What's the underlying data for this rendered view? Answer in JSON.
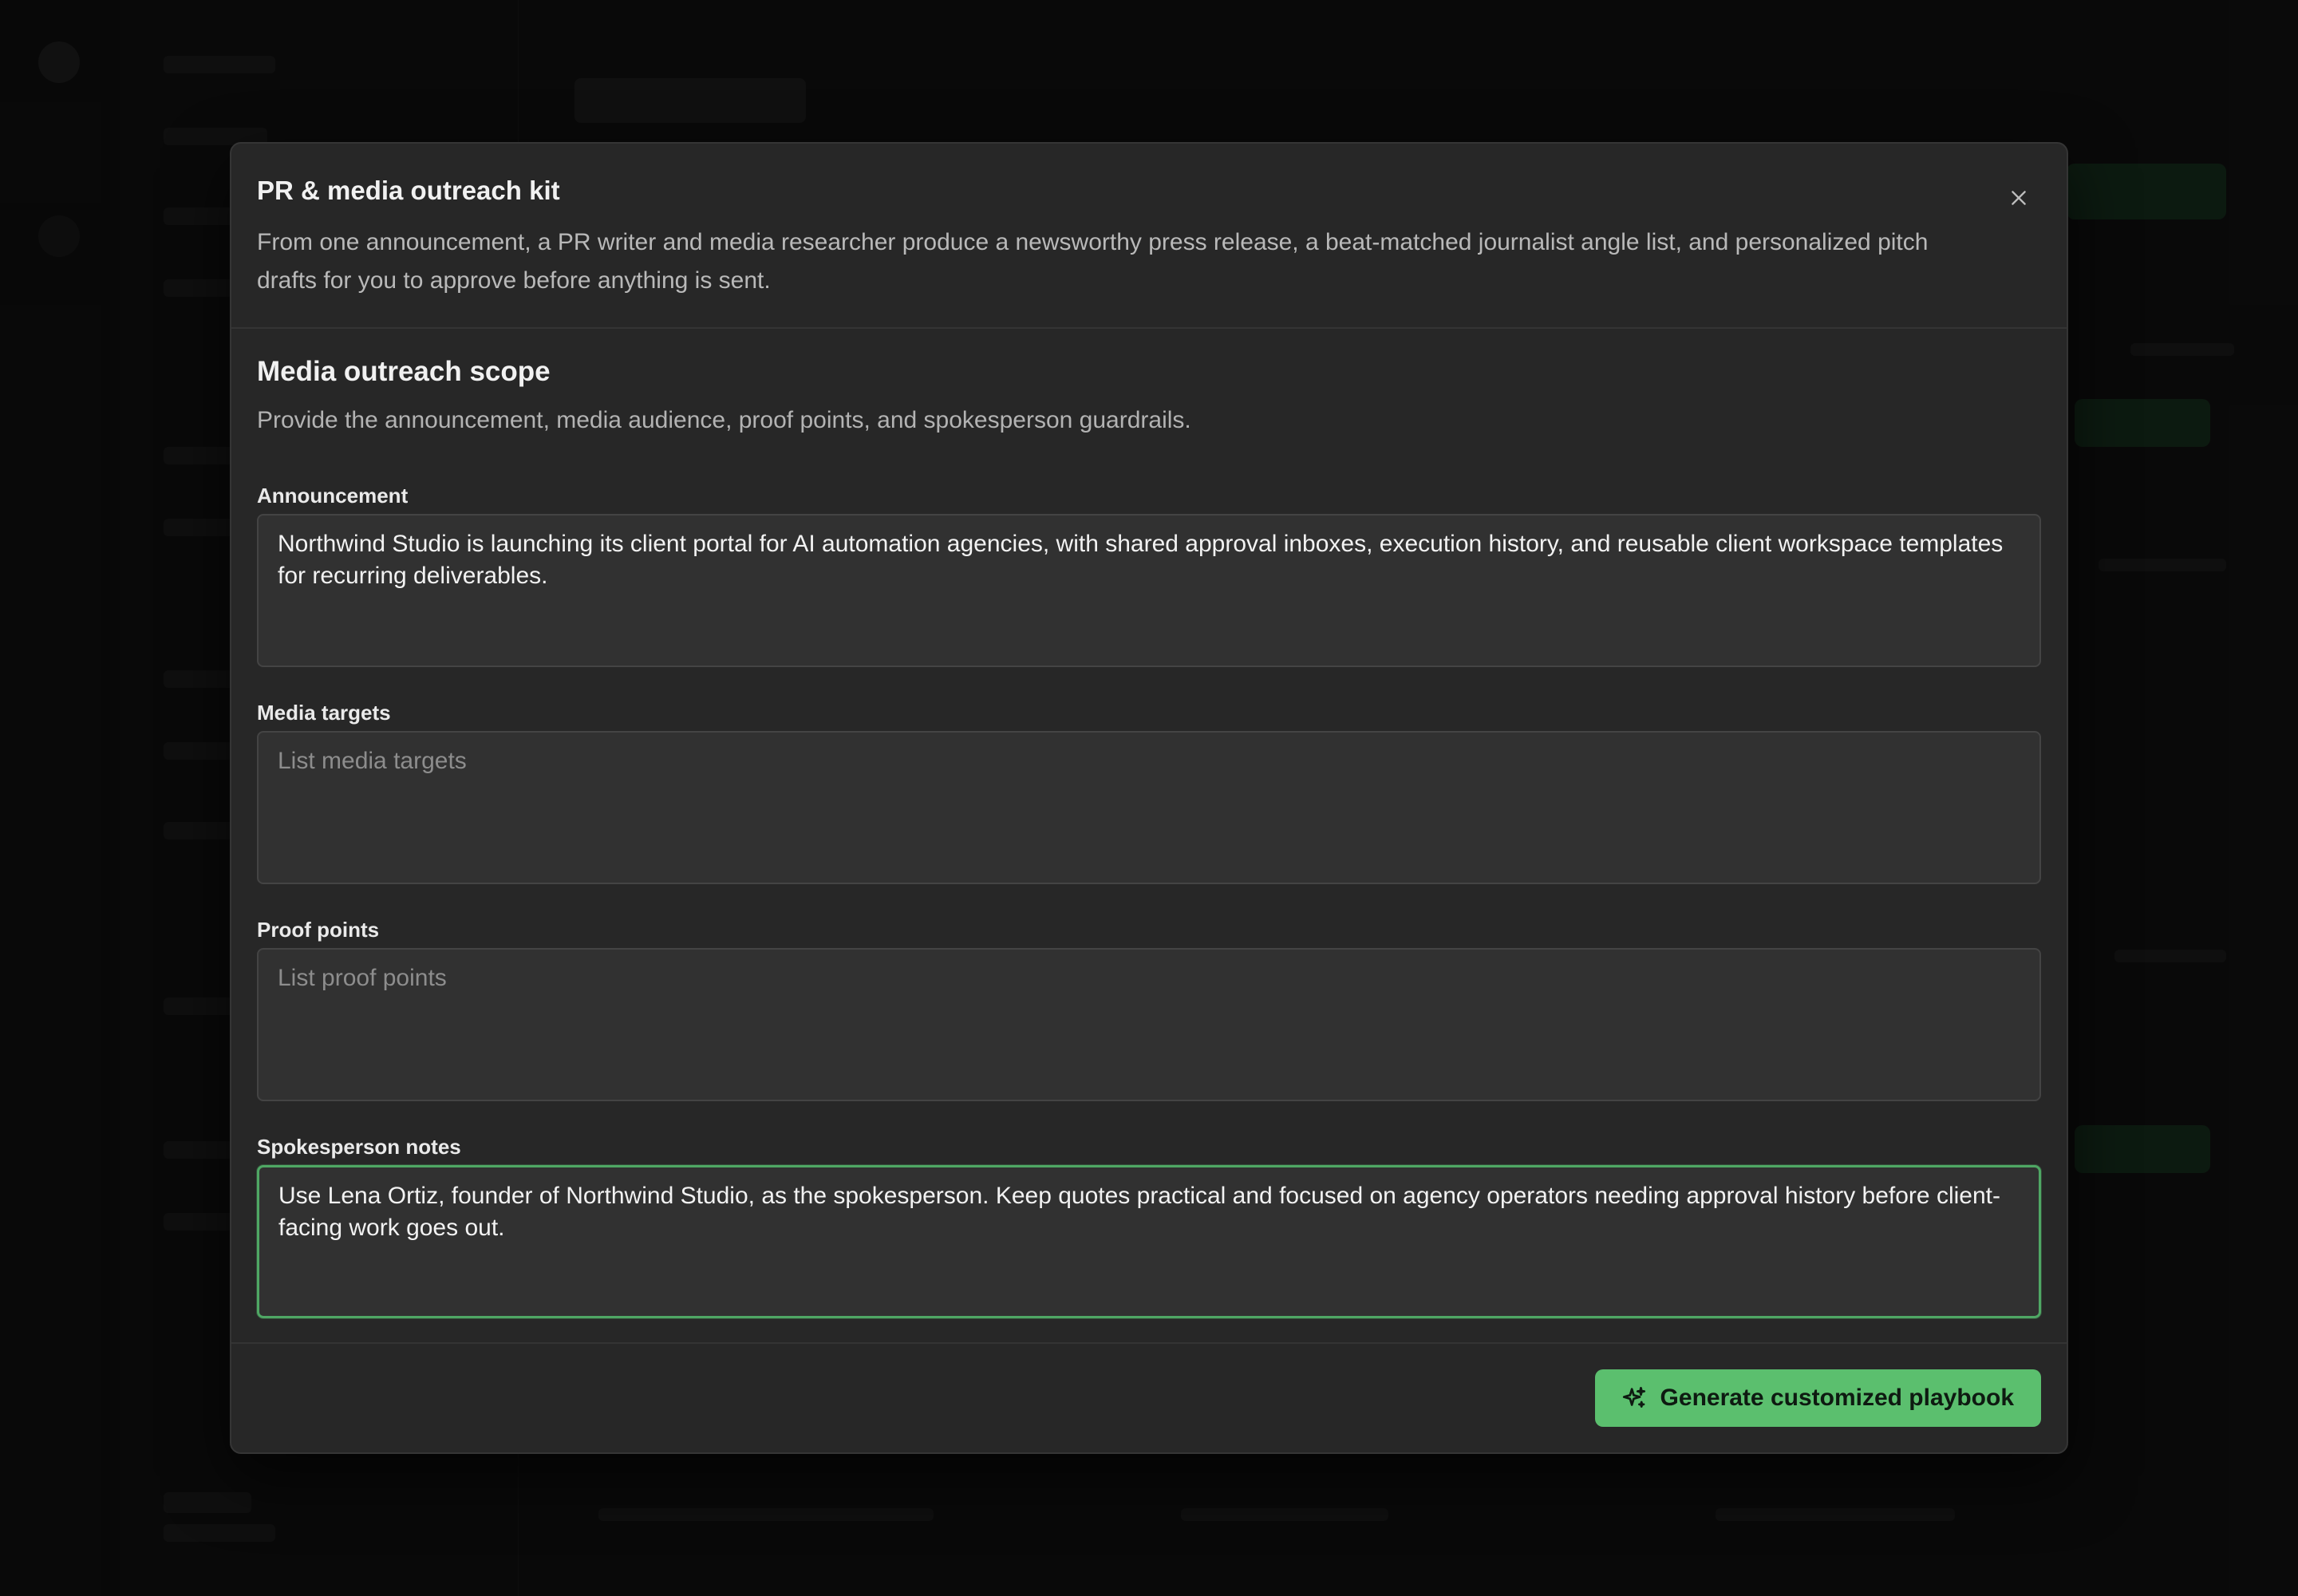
{
  "modal": {
    "title": "PR & media outreach kit",
    "description": "From one announcement, a PR writer and media researcher produce a newsworthy press release, a beat-matched journalist angle list, and personalized pitch drafts for you to approve before anything is sent.",
    "close_icon": "close-icon"
  },
  "section": {
    "title": "Media outreach scope",
    "description": "Provide the announcement, media audience, proof points, and spokesperson guardrails."
  },
  "fields": {
    "announcement": {
      "label": "Announcement",
      "value": "Northwind Studio is launching its client portal for AI automation agencies, with shared approval inboxes, execution history, and reusable client workspace templates for recurring deliverables.",
      "placeholder": ""
    },
    "media_targets": {
      "label": "Media targets",
      "value": "",
      "placeholder": "List media targets"
    },
    "proof_points": {
      "label": "Proof points",
      "value": "",
      "placeholder": "List proof points"
    },
    "spokesperson_notes": {
      "label": "Spokesperson notes",
      "value": "Use Lena Ortiz, founder of Northwind Studio, as the spokesperson. Keep quotes practical and focused on agency operators needing approval history before client-facing work goes out.",
      "placeholder": ""
    }
  },
  "footer": {
    "generate_label": "Generate customized playbook",
    "generate_icon": "sparkle-icon"
  },
  "colors": {
    "accent": "#5bbf6e",
    "focus_border": "#4fa764",
    "modal_bg": "#272727",
    "field_bg": "#313131"
  }
}
